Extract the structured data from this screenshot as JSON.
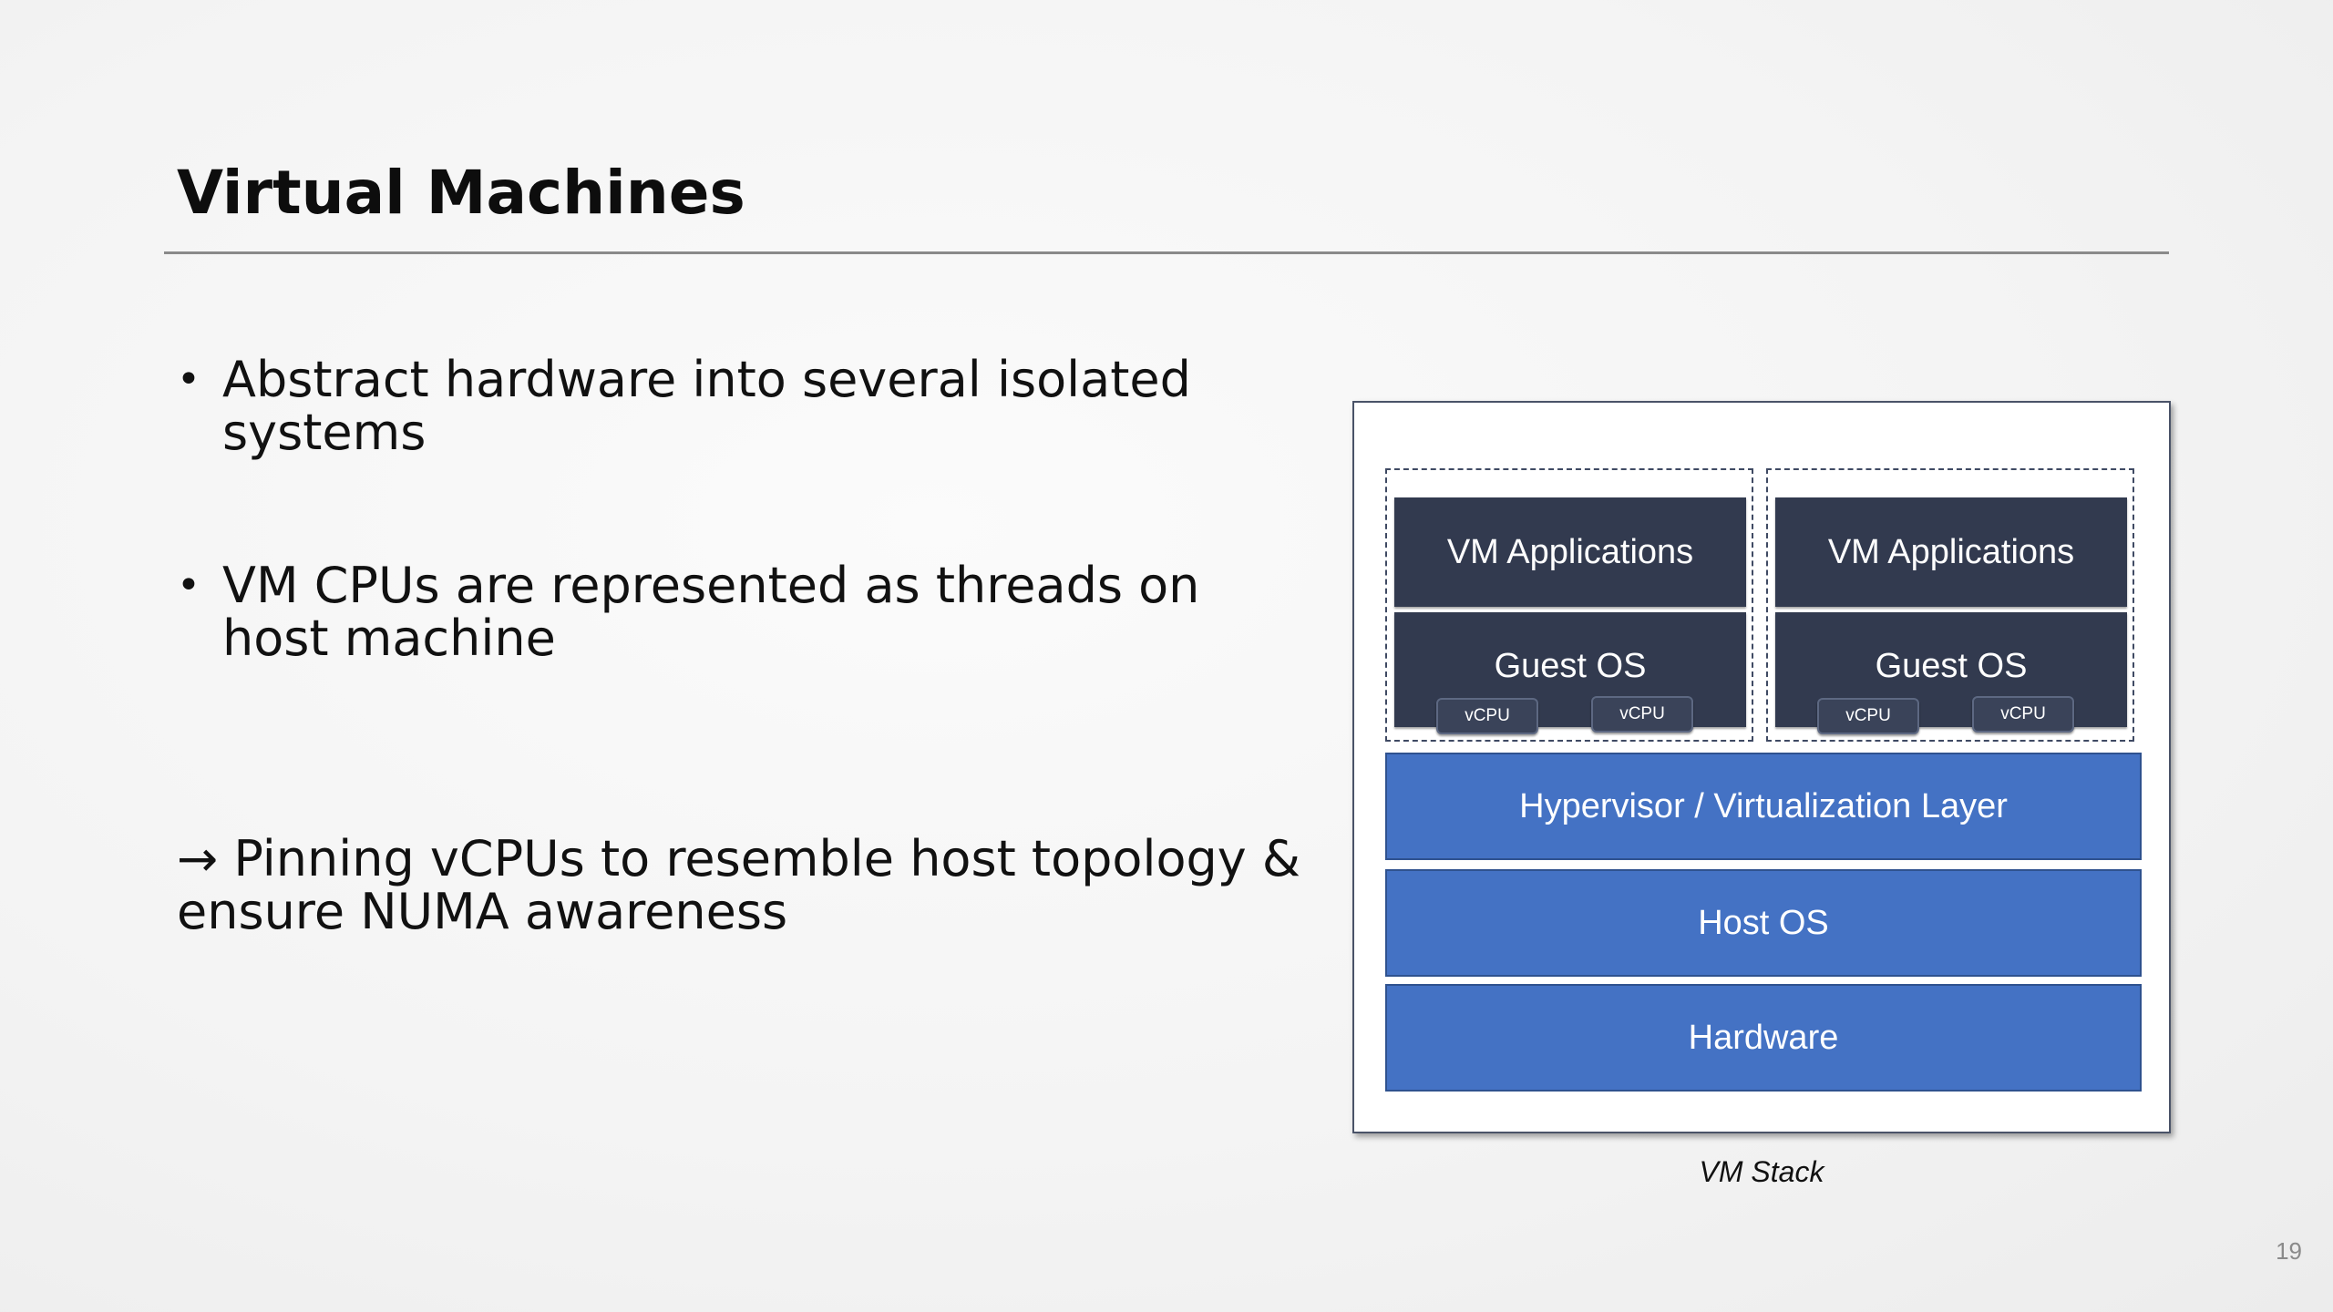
{
  "slide": {
    "title": "Virtual Machines",
    "bullets": [
      "Abstract hardware into several isolated systems",
      "VM CPUs are represented as threads on host machine"
    ],
    "bullet_symbol": "•",
    "conclusion": "→ Pinning vCPUs to resemble host topology & ensure NUMA awareness",
    "page_number": "19"
  },
  "diagram": {
    "vms": [
      {
        "applications_label": "VM Applications",
        "guest_os_label": "Guest OS",
        "vcpus": [
          "vCPU",
          "vCPU"
        ]
      },
      {
        "applications_label": "VM Applications",
        "guest_os_label": "Guest OS",
        "vcpus": [
          "vCPU",
          "vCPU"
        ]
      }
    ],
    "layers": {
      "hypervisor": "Hypervisor / Virtualization Layer",
      "host_os": "Host OS",
      "hardware": "Hardware"
    },
    "caption": "VM Stack",
    "colors": {
      "vm_block": "#323a4f",
      "layer": "#4472c4",
      "layer_border": "#2f528f"
    }
  }
}
